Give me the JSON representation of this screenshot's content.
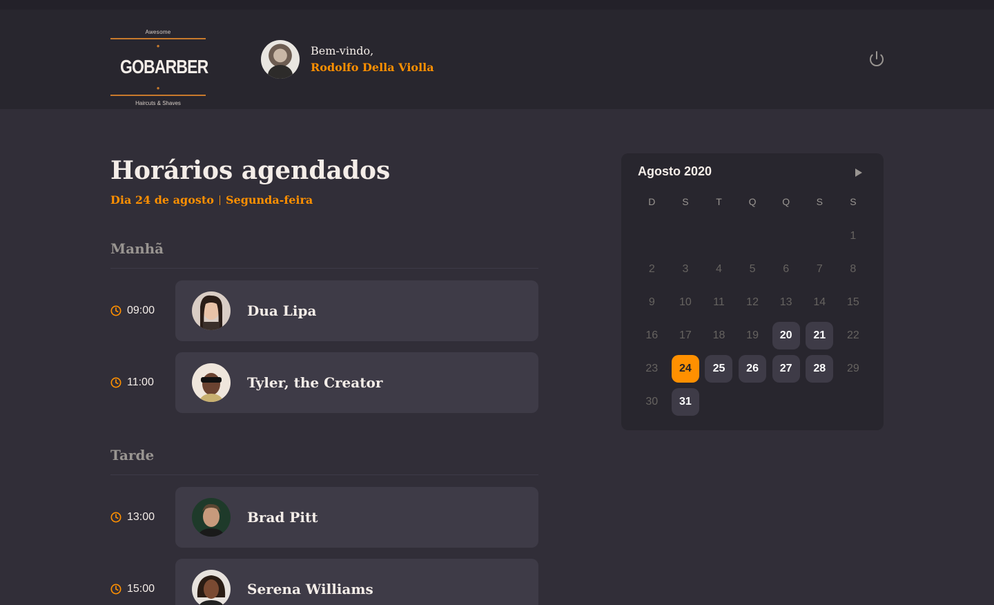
{
  "header": {
    "logo": {
      "top": "Awesome",
      "brand": "GOBARBER",
      "bottom": "Haircuts & Shaves"
    },
    "welcome": "Bem-vindo,",
    "user_name": "Rodolfo Della Violla"
  },
  "schedule": {
    "title": "Horários agendados",
    "day_label": "Dia 24 de agosto",
    "weekday_label": "Segunda-feira",
    "morning_title": "Manhã",
    "afternoon_title": "Tarde",
    "appointments": [
      {
        "time": "09:00",
        "name": "Dua Lipa"
      },
      {
        "time": "11:00",
        "name": "Tyler, the Creator"
      },
      {
        "time": "13:00",
        "name": "Brad Pitt"
      },
      {
        "time": "15:00",
        "name": "Serena Williams"
      }
    ]
  },
  "calendar": {
    "month": "Agosto 2020",
    "weekdays": [
      "D",
      "S",
      "T",
      "Q",
      "Q",
      "S",
      "S"
    ],
    "days": [
      "",
      "",
      "",
      "",
      "",
      "",
      "1",
      "2",
      "3",
      "4",
      "5",
      "6",
      "7",
      "8",
      "9",
      "10",
      "11",
      "12",
      "13",
      "14",
      "15",
      "16",
      "17",
      "18",
      "19",
      "20",
      "21",
      "22",
      "23",
      "24",
      "25",
      "26",
      "27",
      "28",
      "29",
      "30",
      "31"
    ],
    "available_days": [
      "20",
      "21",
      "25",
      "26",
      "27",
      "28",
      "31"
    ],
    "selected_day": "24"
  },
  "colors": {
    "accent": "#ff9000",
    "background": "#312e38",
    "header_bg": "#28262e",
    "card_bg": "#3e3b47"
  }
}
